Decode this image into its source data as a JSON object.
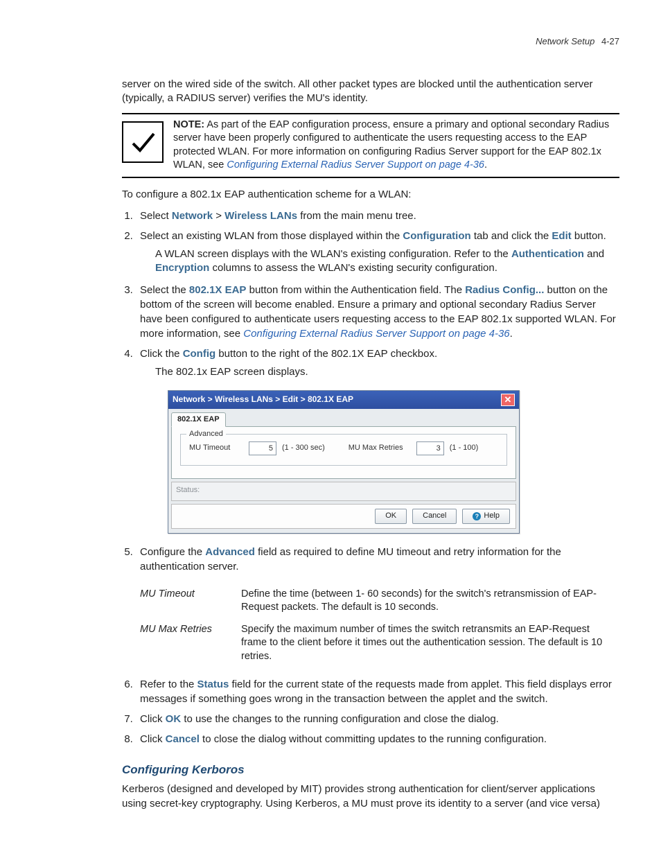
{
  "header": {
    "title": "Network Setup",
    "page": "4-27"
  },
  "intro": "server on the wired side of the switch. All other packet types are blocked until the authentication server (typically, a RADIUS server) verifies the MU's identity.",
  "note": {
    "label": "NOTE:",
    "text_a": " As part of the EAP configuration process, ensure a primary and optional secondary Radius server have been properly configured to authenticate the users requesting access to the EAP protected WLAN. For more information on configuring Radius Server support for the EAP 802.1x WLAN, see ",
    "link": "Configuring External Radius Server Support on page 4-36",
    "text_b": "."
  },
  "lead": "To configure a 802.1x EAP authentication scheme for a WLAN:",
  "steps": {
    "s1": {
      "pre": "Select ",
      "m1": "Network",
      "gt": " > ",
      "m2": "Wireless LANs",
      "post": " from the main menu tree."
    },
    "s2": {
      "line": {
        "a": "Select an existing WLAN from those displayed within the ",
        "b": "Configuration",
        "c": " tab and click the ",
        "d": "Edit",
        "e": " button."
      },
      "p2": {
        "a": "A WLAN screen displays with the WLAN's existing configuration. Refer to the ",
        "b": "Authentication",
        "c": " and ",
        "d": "Encryption",
        "e": " columns to assess the WLAN's existing security configuration."
      }
    },
    "s3": {
      "a": "Select the ",
      "b": "802.1X EAP",
      "c": " button from within the Authentication field. The ",
      "d": "Radius Config...",
      "e": " button on the bottom of the screen will become enabled. Ensure a primary and optional secondary Radius Server have been configured to authenticate users requesting access to the EAP 802.1x supported WLAN. For more information, see ",
      "link": "Configuring External Radius Server Support on page 4-36",
      "f": "."
    },
    "s4": {
      "a": "Click the ",
      "b": "Config",
      "c": " button to the right of the 802.1X EAP checkbox.",
      "p2": "The 802.1x EAP screen displays."
    },
    "s5": {
      "a": "Configure the ",
      "b": "Advanced",
      "c": " field as required to define MU timeout and retry information for the authentication server."
    },
    "s6": {
      "a": "Refer to the ",
      "b": "Status",
      "c": " field for the current state of the requests made from applet. This field displays error messages if something goes wrong in the transaction between the applet and the switch."
    },
    "s7": {
      "a": "Click ",
      "b": "OK",
      "c": " to use the changes to the running configuration and close the dialog."
    },
    "s8": {
      "a": "Click ",
      "b": "Cancel",
      "c": " to close the dialog without committing updates to the running configuration."
    }
  },
  "dialog": {
    "breadcrumb": "Network  >  Wireless LANs  >  Edit  >  802.1X EAP",
    "tab": "802.1X EAP",
    "group": "Advanced",
    "mu_timeout_label": "MU Timeout",
    "mu_timeout_value": "5",
    "mu_timeout_hint": "(1 - 300 sec)",
    "mu_retries_label": "MU Max Retries",
    "mu_retries_value": "3",
    "mu_retries_hint": "(1 - 100)",
    "status_label": "Status:",
    "ok": "OK",
    "cancel": "Cancel",
    "help": "Help"
  },
  "defs": {
    "r1": {
      "term": "MU Timeout",
      "desc": "Define the time (between 1- 60 seconds) for the switch's retransmission of EAP-Request packets. The default is 10 seconds."
    },
    "r2": {
      "term": "MU Max Retries",
      "desc": "Specify the maximum number of times the switch retransmits an EAP-Request frame to the client before it times out the authentication session. The default is 10 retries."
    }
  },
  "section": {
    "title": "Configuring Kerboros",
    "para": "Kerberos (designed and developed by MIT) provides strong authentication for client/server applications using secret-key cryptography. Using Kerberos, a MU must prove its identity to a server (and vice versa)"
  }
}
